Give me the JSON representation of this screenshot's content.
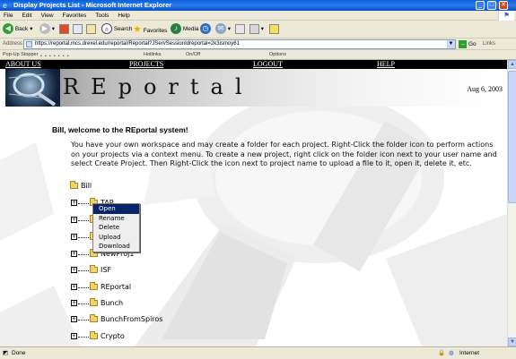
{
  "window": {
    "title": "Display Projects List - Microsoft Internet Explorer",
    "controls": [
      "_",
      "□",
      "✕"
    ]
  },
  "menu": [
    "File",
    "Edit",
    "View",
    "Favorites",
    "Tools",
    "Help"
  ],
  "toolbar": {
    "back": "Back",
    "search": "Search",
    "favorites": "Favorites",
    "media": "Media"
  },
  "address": {
    "label": "Address",
    "url": "https://reportal.mcs.drexel.edu/reportal/Reportal?JServSessionIdreportal=2k3ismoy61",
    "go": "Go",
    "links": "Links"
  },
  "popupbar": {
    "label": "Pop-Up Stopper",
    "hotlinks": "Hotlinks",
    "onoff": "On/Off",
    "options": "Options"
  },
  "nav": {
    "about": "ABOUT US",
    "projects": "PROJECTS",
    "logout": "LOGOUT",
    "help": "HELP"
  },
  "banner": {
    "title": "REportal",
    "date": "Aug 6, 2003"
  },
  "welcome": "Bill, welcome to the REportal system!",
  "intro": "You have your own workspace and may create a folder for each project. Right-Click the folder icon to perform actions on your projects via a context menu. To create a new project, right click on the folder icon next to your user name and select Create Project. Then Right-Click the icon next to project name to upload a file to it, open it, delete it, etc.",
  "tree": {
    "root": "Bill",
    "items": [
      "TAP",
      "",
      "",
      "NewProj1",
      "ISF",
      "REportal",
      "Bunch",
      "BunchFromSpiros",
      "Crypto"
    ]
  },
  "context_menu": {
    "items": [
      "Open",
      "Rename",
      "Delete",
      "Upload",
      "Download"
    ],
    "selected": "Open"
  },
  "status": {
    "text": "Done",
    "zone": "Internet"
  }
}
